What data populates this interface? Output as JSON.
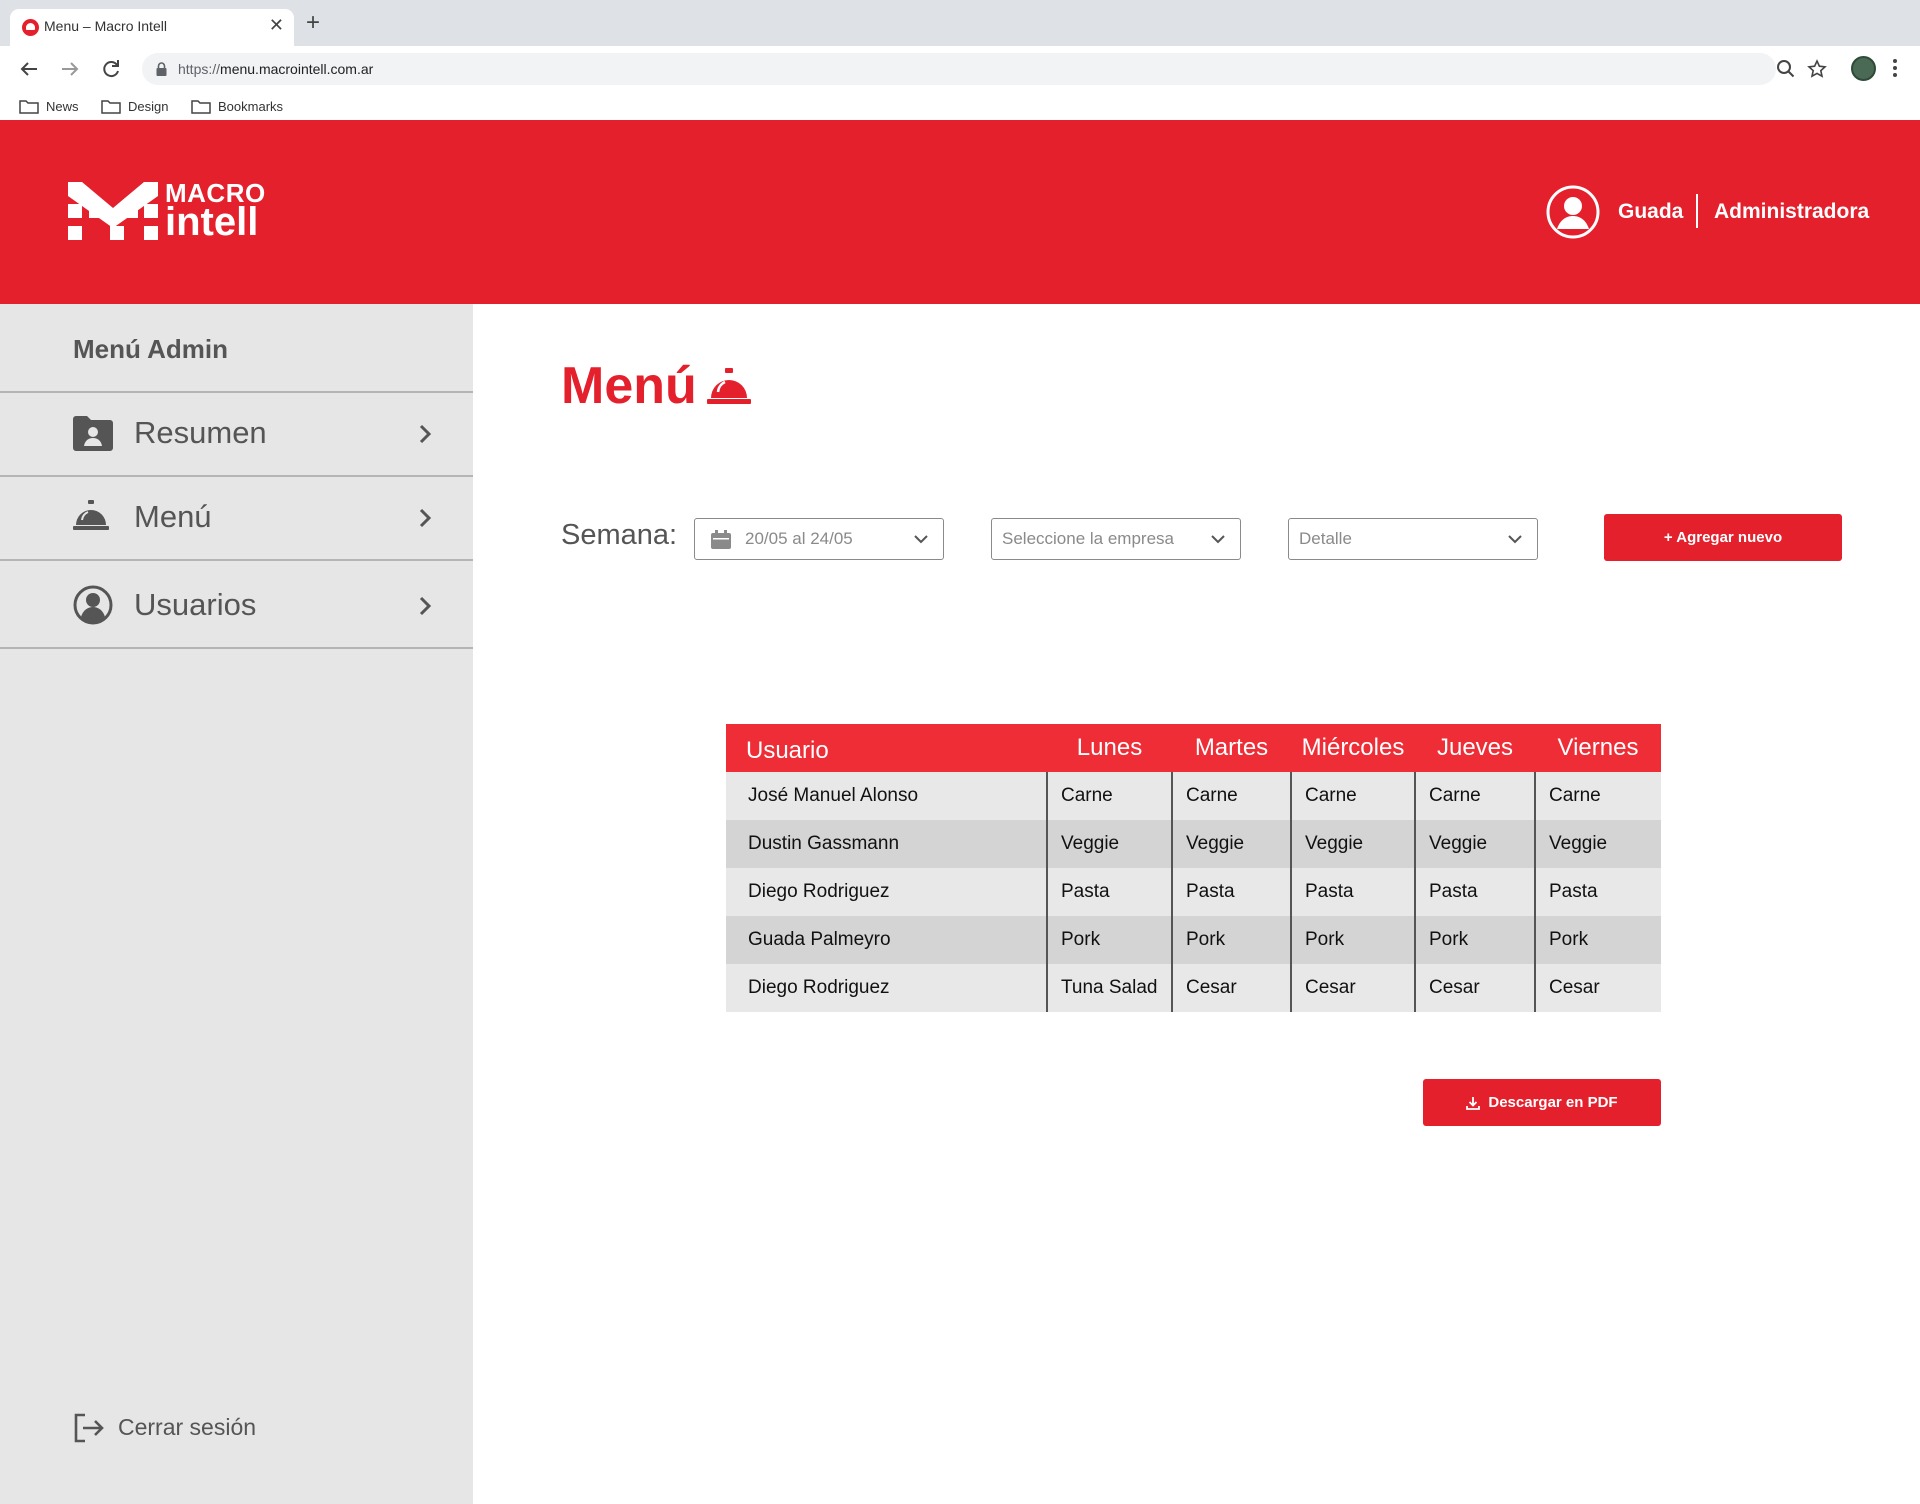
{
  "browser": {
    "tab_title": "Menu – Macro Intell",
    "url_scheme": "https://",
    "url_host": "menu.macrointell.com.ar",
    "bookmarks": [
      "News",
      "Design",
      "Bookmarks"
    ]
  },
  "header": {
    "logo_line1": "MACRO",
    "logo_line2": "intell",
    "user_name": "Guada",
    "user_role": "Administradora"
  },
  "sidebar": {
    "title": "Menú Admin",
    "items": [
      {
        "label": "Resumen",
        "icon": "folder-user-icon"
      },
      {
        "label": "Menú",
        "icon": "service-bell-icon"
      },
      {
        "label": "Usuarios",
        "icon": "user-circle-icon"
      }
    ],
    "logout_label": "Cerrar sesión"
  },
  "main": {
    "title": "Menú",
    "week_label": "Semana:",
    "week_value": "20/05 al 24/05",
    "company_placeholder": "Seleccione la empresa",
    "detail_placeholder": "Detalle",
    "add_button": "+ Agregar nuevo",
    "pdf_button": "Descargar en PDF"
  },
  "table": {
    "headers": [
      "Usuario",
      "Lunes",
      "Martes",
      "Miércoles",
      "Jueves",
      "Viernes"
    ],
    "rows": [
      [
        "José Manuel Alonso",
        "Carne",
        "Carne",
        "Carne",
        "Carne",
        "Carne"
      ],
      [
        "Dustin Gassmann",
        "Veggie",
        "Veggie",
        "Veggie",
        "Veggie",
        "Veggie"
      ],
      [
        "Diego Rodriguez",
        "Pasta",
        "Pasta",
        "Pasta",
        "Pasta",
        "Pasta"
      ],
      [
        "Guada Palmeyro",
        "Pork",
        "Pork",
        "Pork",
        "Pork",
        "Pork"
      ],
      [
        "Diego Rodriguez",
        "Tuna Salad",
        "Cesar",
        "Cesar",
        "Cesar",
        "Cesar"
      ]
    ]
  },
  "colors": {
    "brand_red": "#e4202c",
    "table_header": "#ee2d36",
    "sidebar_bg": "#e6e6e6"
  }
}
